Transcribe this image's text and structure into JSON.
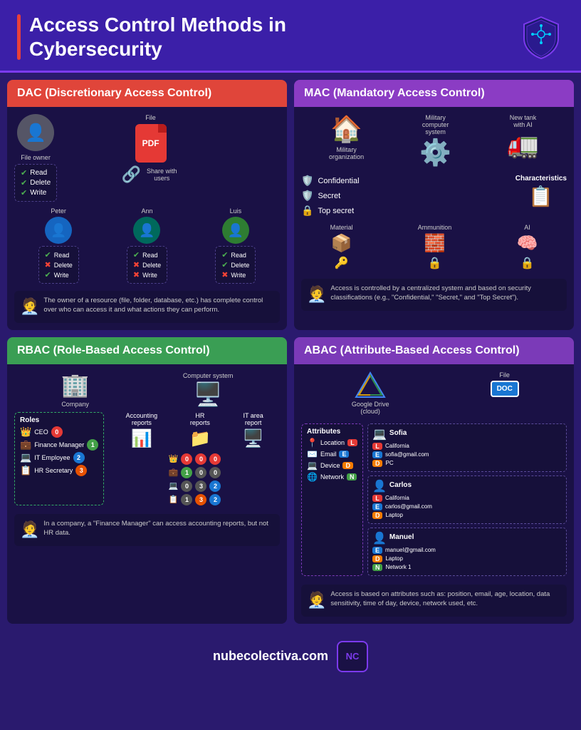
{
  "header": {
    "title_line1": "Access Control Methods in",
    "title_line2": "Cybersecurity",
    "website": "nubecolectiva.com"
  },
  "dac": {
    "section_title": "DAC (Discretionary Access Control)",
    "file_label": "File",
    "owner_label": "File owner",
    "share_label": "Share with users",
    "users": [
      {
        "name": "Peter"
      },
      {
        "name": "Ann"
      },
      {
        "name": "Luis"
      }
    ],
    "owner_perms": [
      "Read",
      "Delete",
      "Write"
    ],
    "user_perms": [
      {
        "read": true,
        "delete": false,
        "write": true
      },
      {
        "read": true,
        "delete": true,
        "write": true
      },
      {
        "read": true,
        "delete": false,
        "write": false
      }
    ],
    "description": "The owner of a resource (file, folder, database, etc.) has complete control over who can access it and what actions they can perform."
  },
  "mac": {
    "section_title": "MAC (Mandatory Access Control)",
    "entities": [
      {
        "name": "Military organization",
        "icon": "🏠"
      },
      {
        "name": "Military computer system",
        "icon": "⚙️"
      },
      {
        "name": "New tank with AI",
        "icon": "🚛"
      }
    ],
    "characteristics_label": "Characteristics",
    "classifications": [
      {
        "label": "Confidential",
        "icon": "🛡️"
      },
      {
        "label": "Secret",
        "icon": "🛡️"
      },
      {
        "label": "Top secret",
        "icon": "🔒"
      }
    ],
    "sub_entities": [
      {
        "name": "Material",
        "icon": "📦"
      },
      {
        "name": "Ammunition",
        "icon": "🧱"
      },
      {
        "name": "AI",
        "icon": "🧠"
      }
    ],
    "description": "Access is controlled by a centralized system and based on security classifications (e.g., \"Confidential,\" \"Secret,\" and \"Top Secret\")."
  },
  "rbac": {
    "section_title": "RBAC (Role-Based Access Control)",
    "company_label": "Company",
    "computer_label": "Computer system",
    "roles_title": "Roles",
    "roles": [
      {
        "name": "CEO",
        "badge": "0",
        "badge_color": "red"
      },
      {
        "name": "Finance Manager",
        "badge": "1",
        "badge_color": "green"
      },
      {
        "name": "IT Employee",
        "badge": "2",
        "badge_color": "blue"
      },
      {
        "name": "HR Secretary",
        "badge": "3",
        "badge_color": "orange"
      }
    ],
    "reports": [
      {
        "name": "Accounting reports"
      },
      {
        "name": "HR reports"
      },
      {
        "name": "IT area report"
      }
    ],
    "description": "In a company, a \"Finance Manager\" can access accounting reports, but not HR data."
  },
  "abac": {
    "section_title": "ABAC (Attribute-Based Access Control)",
    "cloud_label": "Google Drive (cloud)",
    "file_label": "File",
    "attributes_title": "Attributes",
    "attributes": [
      {
        "icon": "📍",
        "label": "Location",
        "key": "L"
      },
      {
        "icon": "✉️",
        "label": "Email",
        "key": "E"
      },
      {
        "icon": "💻",
        "label": "Device",
        "key": "D"
      },
      {
        "icon": "🌐",
        "label": "Network",
        "key": "N"
      }
    ],
    "users": [
      {
        "name": "Sofia",
        "attrs": [
          {
            "key": "L",
            "value": "California"
          },
          {
            "key": "E",
            "value": "sofia@gmail.com"
          },
          {
            "key": "D",
            "value": "PC"
          }
        ]
      },
      {
        "name": "Carlos",
        "attrs": [
          {
            "key": "L",
            "value": "California"
          },
          {
            "key": "E",
            "value": "carlos@gmail.com"
          },
          {
            "key": "D",
            "value": "Laptop"
          }
        ]
      },
      {
        "name": "Manuel",
        "attrs": [
          {
            "key": "E",
            "value": "manuel@gmail.com"
          },
          {
            "key": "D",
            "value": "Laptop"
          },
          {
            "key": "N",
            "value": "Network 1"
          }
        ]
      }
    ],
    "description": "Access is based on attributes such as: position, email, age, location, data sensitivity, time of day, device, network used, etc."
  },
  "footer": {
    "website": "nubecolectiva.com",
    "logo_text": "NC"
  }
}
